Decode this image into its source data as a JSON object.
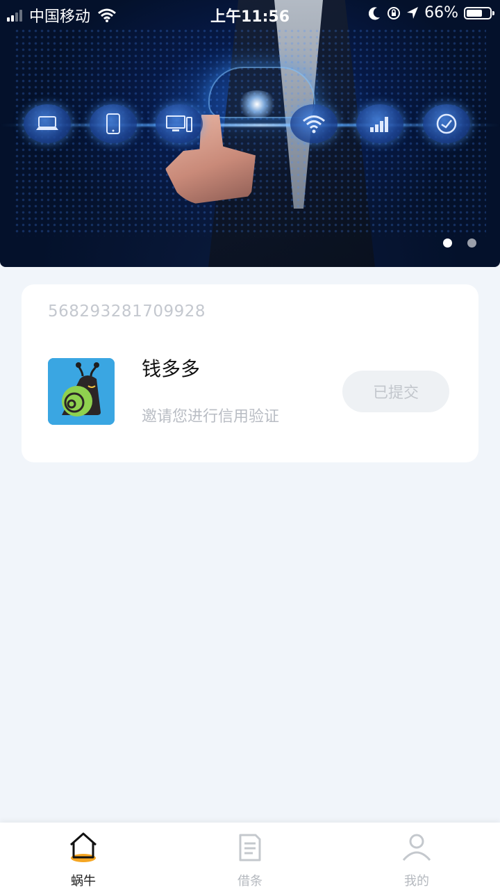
{
  "status_bar": {
    "carrier": "中国移动",
    "time": "上午11:56",
    "battery": "66%"
  },
  "banner": {
    "pages": 2,
    "active_page": 1,
    "tech_icons": [
      "laptop-icon",
      "tablet-icon",
      "desktop-icon",
      "wifi-icon",
      "signal-bars-icon",
      "clock-icon"
    ]
  },
  "card": {
    "number": "568293281709928",
    "app_name": "钱多多",
    "description": "邀请您进行信用验证",
    "button_label": "已提交"
  },
  "tabbar": {
    "tabs": [
      {
        "label": "蜗牛",
        "icon": "home-icon",
        "active": true
      },
      {
        "label": "借条",
        "icon": "document-icon",
        "active": false
      },
      {
        "label": "我的",
        "icon": "user-icon",
        "active": false
      }
    ]
  },
  "colors": {
    "background": "#f1f5fa",
    "accent": "#f5a623",
    "app_icon_bg": "#3aa6e2",
    "inactive": "#b5b9bf"
  }
}
